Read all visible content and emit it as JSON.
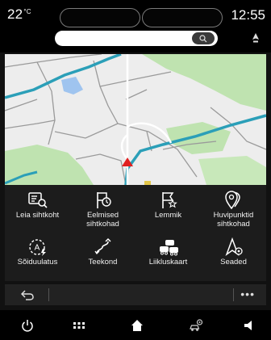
{
  "status": {
    "temperature": "22",
    "temperature_unit": "°C",
    "time": "12:55"
  },
  "search": {
    "placeholder": ""
  },
  "menu": {
    "items": [
      {
        "label": "Leia sihtkoht",
        "icon": "find-destination-icon"
      },
      {
        "label": "Eelmised sihtkohad",
        "icon": "previous-destinations-icon"
      },
      {
        "label": "Lemmik",
        "icon": "favourite-flag-icon"
      },
      {
        "label": "Huvipunktid sihtkohad",
        "icon": "poi-icon"
      },
      {
        "label": "Sõiduulatus",
        "icon": "driving-range-icon"
      },
      {
        "label": "Teekond",
        "icon": "route-icon"
      },
      {
        "label": "Liikluskaart",
        "icon": "traffic-map-icon"
      },
      {
        "label": "Seaded",
        "icon": "settings-icon"
      }
    ]
  },
  "subbar": {
    "more": "•••"
  },
  "colors": {
    "route": "#2b9fb8",
    "park": "#bfe3b0",
    "water": "#9fc4ef",
    "vehicle": "#e02020"
  }
}
